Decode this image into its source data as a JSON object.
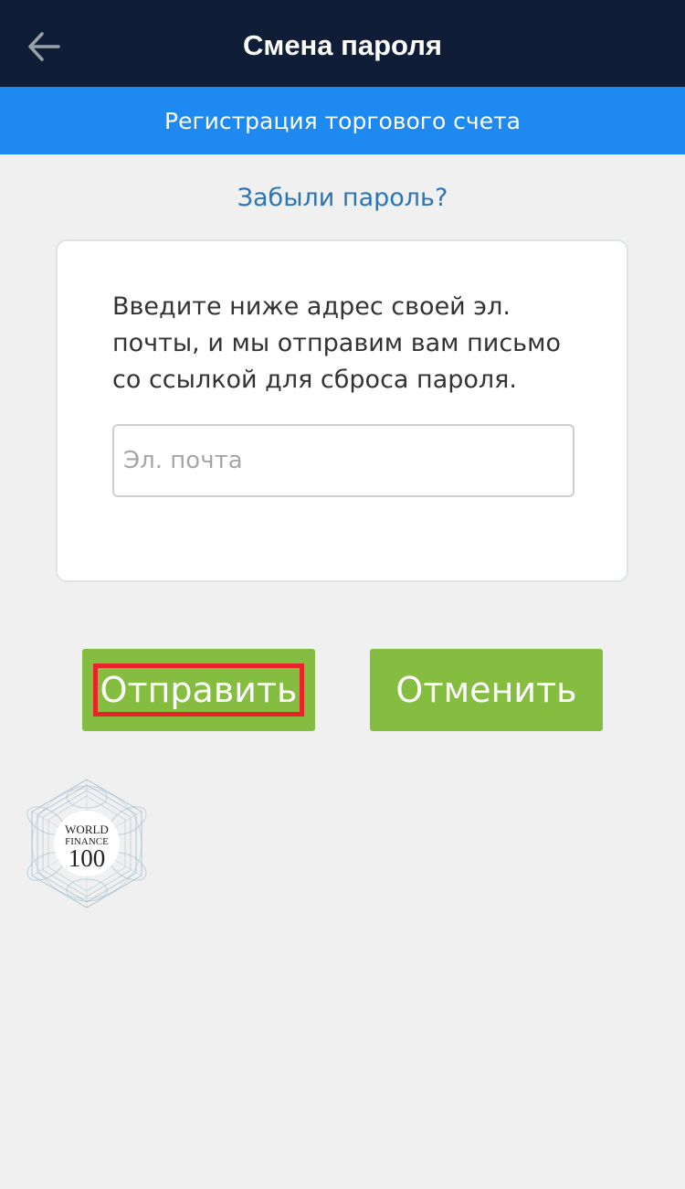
{
  "header": {
    "title": "Смена пароля",
    "back_icon": "arrow-left-icon"
  },
  "banner": {
    "label": "Регистрация торгового счета",
    "color": "#1f89f2"
  },
  "forgot_password": {
    "label": "Забыли пароль?"
  },
  "card": {
    "instructions": "Введите ниже адрес своей эл. почты, и мы отправим вам письмо со ссылкой для сброса пароля.",
    "email_field": {
      "placeholder": "Эл. почта",
      "value": ""
    }
  },
  "actions": {
    "send_label": "Отправить",
    "cancel_label": "Отменить",
    "button_color": "#84bd3f",
    "highlight_color": "#e8232a"
  },
  "logo": {
    "line1": "WORLD",
    "line2": "FINANCE",
    "line3": "100"
  }
}
